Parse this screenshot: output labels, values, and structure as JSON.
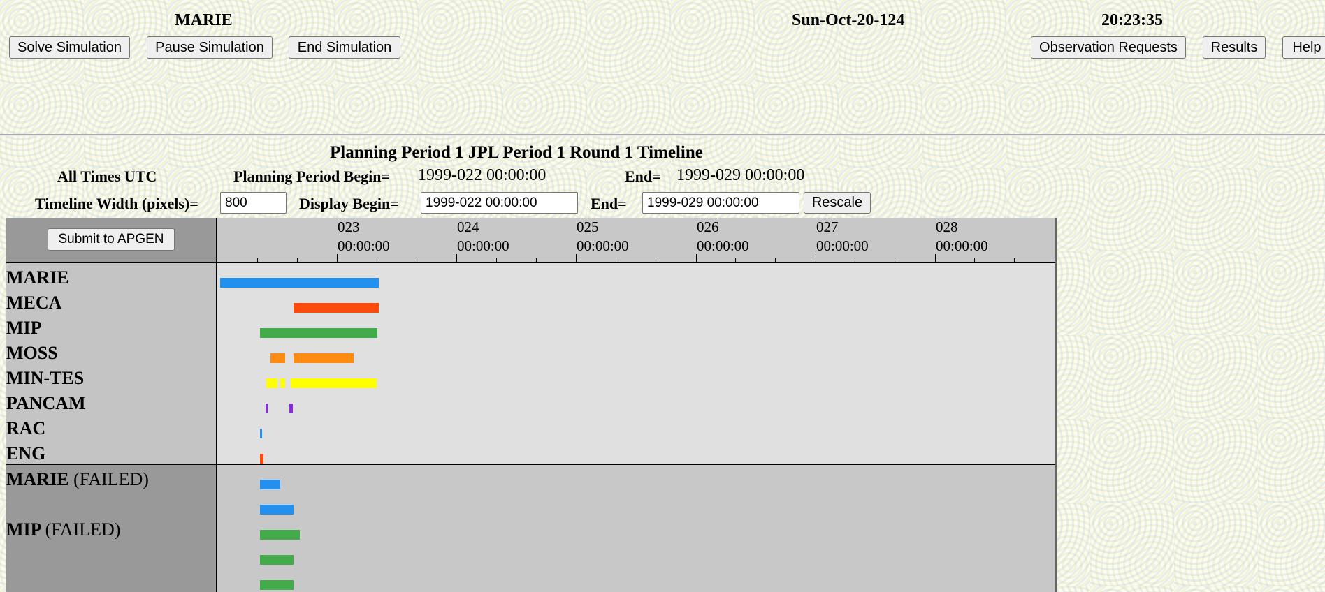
{
  "header": {
    "user": "MARIE",
    "date": "Sun-Oct-20-124",
    "time": "20:23:35"
  },
  "toolbar": {
    "solve_label": "Solve Simulation",
    "pause_label": "Pause Simulation",
    "end_label": "End Simulation",
    "obs_requests_label": "Observation Requests",
    "results_label": "Results",
    "help_label": "Help"
  },
  "info": {
    "title": "Planning Period 1 JPL Period 1 Round 1 Timeline",
    "all_times": "All Times UTC",
    "pp_begin_label": "Planning Period Begin=",
    "pp_begin_value": "1999-022 00:00:00",
    "pp_end_label": "End=",
    "pp_end_value": "1999-029 00:00:00",
    "width_label": "Timeline Width (pixels)=",
    "width_value": "800",
    "display_begin_label": "Display Begin=",
    "display_begin_value": "1999-022 00:00:00",
    "display_end_label": "End=",
    "display_end_value": "1999-029 00:00:00",
    "rescale_label": "Rescale"
  },
  "timeline": {
    "submit_label": "Submit to APGEN",
    "axis": [
      {
        "day": "023",
        "time": "00:00:00"
      },
      {
        "day": "024",
        "time": "00:00:00"
      },
      {
        "day": "025",
        "time": "00:00:00"
      },
      {
        "day": "026",
        "time": "00:00:00"
      },
      {
        "day": "027",
        "time": "00:00:00"
      },
      {
        "day": "028",
        "time": "00:00:00"
      }
    ],
    "rows": [
      {
        "label": "MARIE"
      },
      {
        "label": "MECA"
      },
      {
        "label": "MIP"
      },
      {
        "label": "MOSS"
      },
      {
        "label": "MIN-TES"
      },
      {
        "label": "PANCAM"
      },
      {
        "label": "RAC"
      },
      {
        "label": "ENG"
      }
    ],
    "failed_rows": [
      {
        "label": "MARIE",
        "status": "(FAILED)"
      },
      {
        "label": "MIP",
        "status": "(FAILED)"
      }
    ],
    "colors": {
      "MARIE": "#2490ee",
      "MECA": "#ff4a0e",
      "MIP": "#43ab4a",
      "MOSS": "#ff8c12",
      "MIN-TES": "#ffff00",
      "PANCAM": "#8a2be2",
      "RAC": "#2490ee",
      "ENG": "#ff4a0e"
    }
  }
}
